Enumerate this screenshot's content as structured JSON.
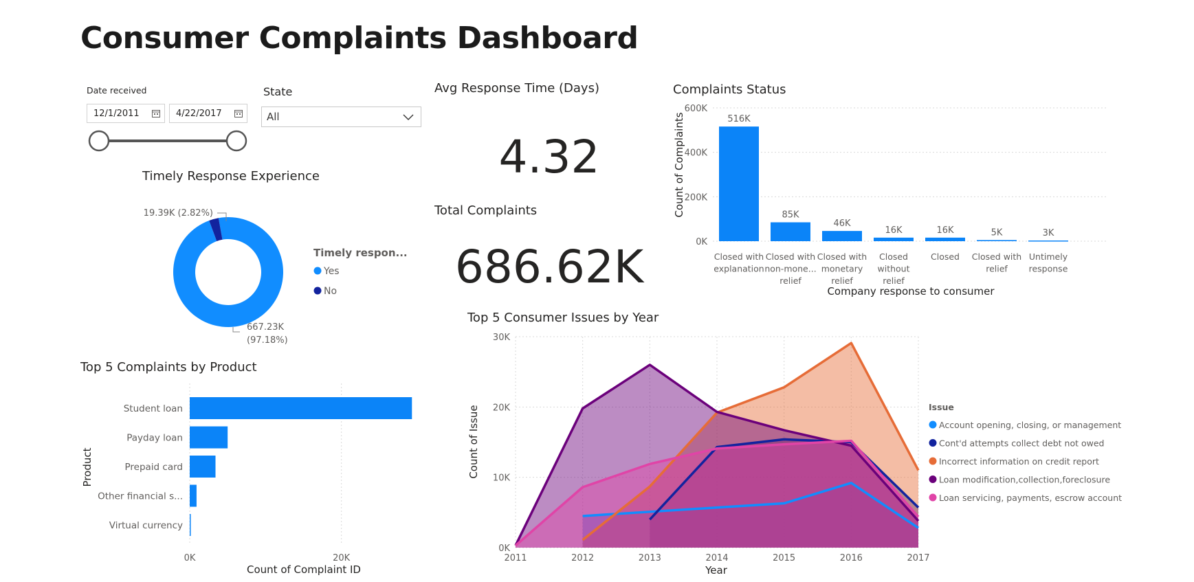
{
  "page": {
    "title": "Consumer Complaints Dashboard"
  },
  "date_filter": {
    "label": "Date received",
    "start": "12/1/2011",
    "end": "4/22/2017",
    "slider_start_fraction": 0,
    "slider_end_fraction": 1
  },
  "state_filter": {
    "label": "State",
    "selected": "All"
  },
  "avg_response": {
    "title": "Avg Response Time (Days)",
    "value": "4.32"
  },
  "total_complaints": {
    "title": "Total Complaints",
    "value": "686.62K"
  },
  "colors": {
    "accent": "#118DFF",
    "dark_blue": "#12239E",
    "orange": "#E66C37",
    "purple": "#6B007B",
    "pink": "#E044A7",
    "bar": "#0B84F8"
  },
  "chart_data": [
    {
      "id": "timely",
      "type": "pie",
      "title": "Timely Response Experience",
      "legend_title": "Timely respon...",
      "legend_position": "right",
      "slices": [
        {
          "name": "Yes",
          "value": 667.23,
          "label_value": "667.23K",
          "label_pct": "(97.18%)",
          "color": "#118DFF"
        },
        {
          "name": "No",
          "value": 19.39,
          "label_value": "19.39K (2.82%)",
          "label_pct": "",
          "color": "#12239E"
        }
      ]
    },
    {
      "id": "status",
      "type": "bar",
      "title": "Complaints Status",
      "xlabel": "Company response to consumer",
      "ylabel": "Count of Complaints",
      "ylim": [
        0,
        600000
      ],
      "yticks": [
        0,
        200000,
        400000,
        600000
      ],
      "ytick_labels": [
        "0K",
        "200K",
        "400K",
        "600K"
      ],
      "grid": true,
      "categories": [
        [
          "Closed with",
          "explanation"
        ],
        [
          "Closed with",
          "non-mone...",
          "relief"
        ],
        [
          "Closed with",
          "monetary",
          "relief"
        ],
        [
          "Closed",
          "without",
          "relief"
        ],
        [
          "Closed"
        ],
        [
          "Closed with",
          "relief"
        ],
        [
          "Untimely",
          "response"
        ]
      ],
      "values": [
        516000,
        85000,
        46000,
        16000,
        16000,
        5000,
        3000
      ],
      "data_labels": [
        "516K",
        "85K",
        "46K",
        "16K",
        "16K",
        "5K",
        "3K"
      ]
    },
    {
      "id": "product",
      "type": "bar",
      "orientation": "horizontal",
      "title": "Top 5 Complaints by Product",
      "xlabel": "Count of Complaint ID",
      "ylabel": "Product",
      "xlim": [
        0,
        30000
      ],
      "xticks": [
        0,
        20000
      ],
      "xtick_labels": [
        "0K",
        "20K"
      ],
      "grid": true,
      "categories": [
        "Student loan",
        "Payday loan",
        "Prepaid card",
        "Other financial s...",
        "Virtual currency"
      ],
      "values": [
        29300,
        5000,
        3400,
        900,
        100
      ]
    },
    {
      "id": "issues",
      "type": "area",
      "title": "Top 5 Consumer Issues by Year",
      "xlabel": "Year",
      "ylabel": "Count of Issue",
      "legend_title": "Issue",
      "legend_position": "right",
      "x": [
        2011,
        2012,
        2013,
        2014,
        2015,
        2016,
        2017
      ],
      "ylim": [
        0,
        30000
      ],
      "yticks": [
        0,
        10000,
        20000,
        30000
      ],
      "ytick_labels": [
        "0K",
        "10K",
        "20K",
        "30K"
      ],
      "grid": true,
      "series": [
        {
          "name": "Account opening, closing, or management",
          "color": "#118DFF",
          "values": [
            null,
            4500,
            5100,
            5700,
            6300,
            9200,
            2800
          ]
        },
        {
          "name": "Cont'd attempts collect debt not owed",
          "color": "#12239E",
          "values": [
            null,
            null,
            4000,
            14300,
            15400,
            15000,
            5700
          ]
        },
        {
          "name": "Incorrect information on credit report",
          "color": "#E66C37",
          "values": [
            null,
            1100,
            8700,
            19200,
            22800,
            29100,
            11000
          ]
        },
        {
          "name": "Loan modification,collection,foreclosure",
          "color": "#6B007B",
          "values": [
            300,
            19800,
            26000,
            19300,
            16700,
            14500,
            3800
          ]
        },
        {
          "name": "Loan servicing, payments, escrow account",
          "color": "#E044A7",
          "values": [
            300,
            8600,
            11900,
            14100,
            14700,
            15200,
            4400
          ]
        }
      ]
    }
  ]
}
